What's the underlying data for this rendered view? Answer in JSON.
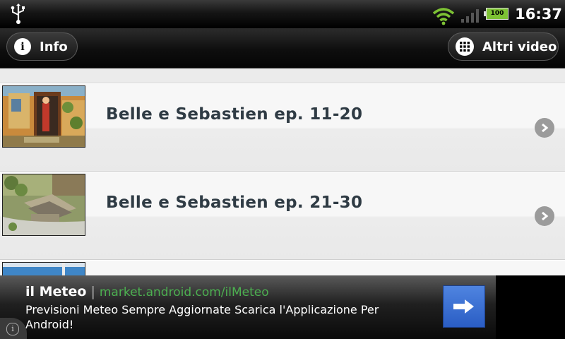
{
  "status_bar": {
    "time": "16:37",
    "battery_level": "100",
    "icons": [
      "usb-icon",
      "wifi-icon",
      "signal-icon",
      "battery-icon"
    ]
  },
  "toolbar": {
    "info_label": "Info",
    "more_videos_label": "Altri video"
  },
  "list": {
    "items": [
      {
        "title": "Belle e Sebastien ep. 11-20"
      },
      {
        "title": "Belle e Sebastien ep. 21-30"
      },
      {
        "title": ""
      }
    ]
  },
  "ad": {
    "title": "il Meteo",
    "separator": "|",
    "url": "market.android.com/ilMeteo",
    "description": "Previsioni Meteo Sempre Aggiornate Scarica l'Applicazione Per Android!"
  },
  "colors": {
    "title_text": "#2f3b44",
    "ad_url": "#4caf50",
    "ad_button": "#2a5dc4",
    "battery": "#7dc234"
  }
}
